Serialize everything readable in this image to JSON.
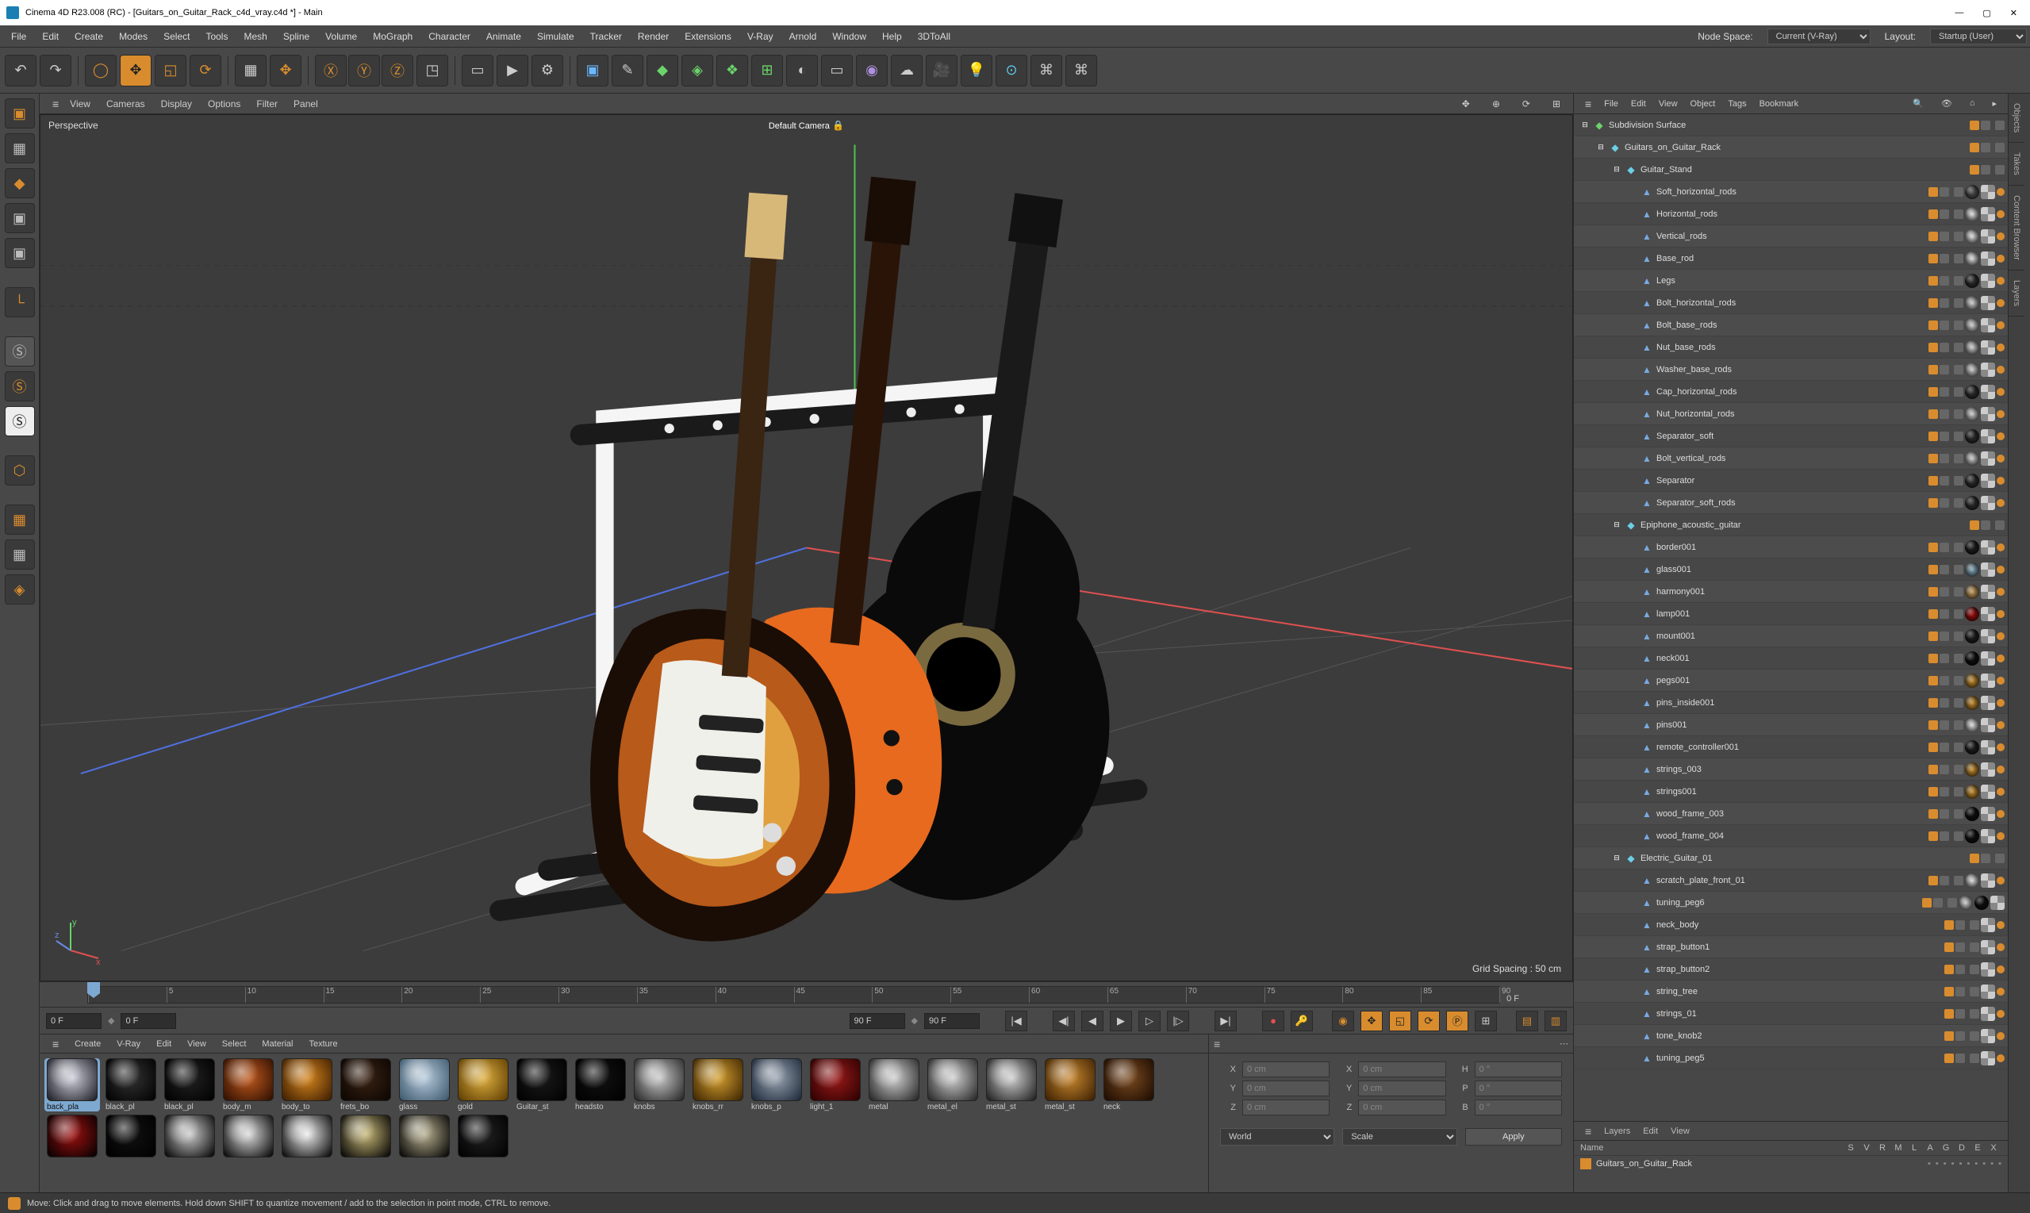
{
  "title": "Cinema 4D R23.008 (RC) - [Guitars_on_Guitar_Rack_c4d_vray.c4d *] - Main",
  "menubar": [
    "File",
    "Edit",
    "Create",
    "Modes",
    "Select",
    "Tools",
    "Mesh",
    "Spline",
    "Volume",
    "MoGraph",
    "Character",
    "Animate",
    "Simulate",
    "Tracker",
    "Render",
    "Extensions",
    "V-Ray",
    "Arnold",
    "Window",
    "Help",
    "3DToAll"
  ],
  "nodeSpaceLabel": "Node Space:",
  "nodeSpaceValue": "Current (V-Ray)",
  "layoutLabel": "Layout:",
  "layoutValue": "Startup (User)",
  "viewportMenus": [
    "View",
    "Cameras",
    "Display",
    "Options",
    "Filter",
    "Panel"
  ],
  "perspectiveLabel": "Perspective",
  "defaultCamera": "Default Camera",
  "gridSpacing": "Grid Spacing : 50 cm",
  "timelineStart": "0 F",
  "timelineStart2": "0 F",
  "timelineEnd": "90 F",
  "timelineEnd2": "90 F",
  "timelineRulerEnd": "0 F",
  "timelineTicks": [
    "0",
    "5",
    "10",
    "15",
    "20",
    "25",
    "30",
    "35",
    "40",
    "45",
    "50",
    "55",
    "60",
    "65",
    "70",
    "75",
    "80",
    "85",
    "90"
  ],
  "materialMenus": [
    "Create",
    "V-Ray",
    "Edit",
    "View",
    "Select",
    "Material",
    "Texture"
  ],
  "materials": [
    {
      "label": "back_pla",
      "c1": "#cfcfdc",
      "c2": "#1a1a22",
      "sel": true
    },
    {
      "label": "black_pl",
      "c1": "#333",
      "c2": "#000"
    },
    {
      "label": "black_pl",
      "c1": "#222",
      "c2": "#000"
    },
    {
      "label": "body_m",
      "c1": "#c15a1e",
      "c2": "#2a0d00"
    },
    {
      "label": "body_to",
      "c1": "#d6861e",
      "c2": "#3a1b00"
    },
    {
      "label": "frets_bo",
      "c1": "#3a2212",
      "c2": "#0a0502"
    },
    {
      "label": "glass",
      "c1": "#b8ccdd",
      "c2": "#3a556a"
    },
    {
      "label": "gold",
      "c1": "#e0b040",
      "c2": "#5a3a00"
    },
    {
      "label": "Guitar_st",
      "c1": "#1a1a1a",
      "c2": "#000"
    },
    {
      "label": "headsto",
      "c1": "#111",
      "c2": "#000"
    },
    {
      "label": "knobs",
      "c1": "#c9c9c9",
      "c2": "#222"
    },
    {
      "label": "knobs_rr",
      "c1": "#d5a030",
      "c2": "#3a2200"
    },
    {
      "label": "knobs_p",
      "c1": "#9aa4b2",
      "c2": "#1a2636"
    },
    {
      "label": "light_1",
      "c1": "#9c1a1a",
      "c2": "#2a0000"
    },
    {
      "label": "metal",
      "c1": "#d0d0d0",
      "c2": "#222"
    },
    {
      "label": "metal_el",
      "c1": "#d0d0d0",
      "c2": "#222"
    },
    {
      "label": "metal_st",
      "c1": "#d0d0d0",
      "c2": "#1a1a1a"
    },
    {
      "label": "metal_st",
      "c1": "#c88830",
      "c2": "#3a1e00"
    },
    {
      "label": "neck",
      "c1": "#7a4a20",
      "c2": "#1a0a00"
    }
  ],
  "materialsRow2Count": 8,
  "coord": {
    "x": "0 cm",
    "y": "0 cm",
    "z": "0 cm",
    "sx": "0 cm",
    "sy": "0 cm",
    "sz": "0 cm",
    "h": "0 °",
    "p": "0 °",
    "b": "0 °",
    "mode1": "World",
    "mode2": "Scale",
    "apply": "Apply"
  },
  "objMenus": [
    "File",
    "Edit",
    "View",
    "Object",
    "Tags",
    "Bookmark"
  ],
  "treeRoot": {
    "name": "Subdivision Surface",
    "icon": "◆",
    "iconColor": "#6bd36b",
    "depth": 0,
    "exp": "⊟",
    "tags": []
  },
  "tree": [
    {
      "name": "Guitars_on_Guitar_Rack",
      "icon": "◆",
      "iconColor": "#6bcfe6",
      "depth": 1,
      "exp": "⊟"
    },
    {
      "name": "Guitar_Stand",
      "icon": "◆",
      "iconColor": "#6bcfe6",
      "depth": 2,
      "exp": "⊟"
    },
    {
      "name": "Soft_horizontal_rods",
      "icon": "▲",
      "iconColor": "#7aa9e0",
      "depth": 3,
      "tags": [
        "sphere:#555",
        "check",
        "dot"
      ]
    },
    {
      "name": "Horizontal_rods",
      "icon": "▲",
      "iconColor": "#7aa9e0",
      "depth": 3,
      "tags": [
        "sphere:#ddd",
        "check",
        "dot"
      ]
    },
    {
      "name": "Vertical_rods",
      "icon": "▲",
      "iconColor": "#7aa9e0",
      "depth": 3,
      "tags": [
        "sphere:#ddd",
        "check",
        "dot"
      ]
    },
    {
      "name": "Base_rod",
      "icon": "▲",
      "iconColor": "#7aa9e0",
      "depth": 3,
      "tags": [
        "sphere:#ddd",
        "check",
        "dot"
      ]
    },
    {
      "name": "Legs",
      "icon": "▲",
      "iconColor": "#7aa9e0",
      "depth": 3,
      "tags": [
        "sphere:#333",
        "check",
        "dot"
      ]
    },
    {
      "name": "Bolt_horizontal_rods",
      "icon": "▲",
      "iconColor": "#7aa9e0",
      "depth": 3,
      "tags": [
        "sphere:#ccc",
        "check",
        "dot"
      ]
    },
    {
      "name": "Bolt_base_rods",
      "icon": "▲",
      "iconColor": "#7aa9e0",
      "depth": 3,
      "tags": [
        "sphere:#ccc",
        "check",
        "dot"
      ]
    },
    {
      "name": "Nut_base_rods",
      "icon": "▲",
      "iconColor": "#7aa9e0",
      "depth": 3,
      "tags": [
        "sphere:#ccc",
        "check",
        "dot"
      ]
    },
    {
      "name": "Washer_base_rods",
      "icon": "▲",
      "iconColor": "#7aa9e0",
      "depth": 3,
      "tags": [
        "sphere:#ccc",
        "check",
        "dot"
      ]
    },
    {
      "name": "Cap_horizontal_rods",
      "icon": "▲",
      "iconColor": "#7aa9e0",
      "depth": 3,
      "tags": [
        "sphere:#333",
        "check",
        "dot"
      ]
    },
    {
      "name": "Nut_horizontal_rods",
      "icon": "▲",
      "iconColor": "#7aa9e0",
      "depth": 3,
      "tags": [
        "sphere:#ccc",
        "check",
        "dot"
      ]
    },
    {
      "name": "Separator_soft",
      "icon": "▲",
      "iconColor": "#7aa9e0",
      "depth": 3,
      "tags": [
        "sphere:#333",
        "check",
        "dot"
      ]
    },
    {
      "name": "Bolt_vertical_rods",
      "icon": "▲",
      "iconColor": "#7aa9e0",
      "depth": 3,
      "tags": [
        "sphere:#ccc",
        "check",
        "dot"
      ]
    },
    {
      "name": "Separator",
      "icon": "▲",
      "iconColor": "#7aa9e0",
      "depth": 3,
      "tags": [
        "sphere:#333",
        "check",
        "dot"
      ]
    },
    {
      "name": "Separator_soft_rods",
      "icon": "▲",
      "iconColor": "#7aa9e0",
      "depth": 3,
      "tags": [
        "sphere:#333",
        "check",
        "dot"
      ]
    },
    {
      "name": "Epiphone_acoustic_guitar",
      "icon": "◆",
      "iconColor": "#6bcfe6",
      "depth": 2,
      "exp": "⊟"
    },
    {
      "name": "border001",
      "icon": "▲",
      "iconColor": "#7aa9e0",
      "depth": 3,
      "tags": [
        "sphere:#222",
        "check",
        "dot"
      ]
    },
    {
      "name": "glass001",
      "icon": "▲",
      "iconColor": "#7aa9e0",
      "depth": 3,
      "tags": [
        "sphere:#8ab",
        "check",
        "dot"
      ]
    },
    {
      "name": "harmony001",
      "icon": "▲",
      "iconColor": "#7aa9e0",
      "depth": 3,
      "tags": [
        "sphere:#c8a060",
        "check",
        "dot"
      ]
    },
    {
      "name": "lamp001",
      "icon": "▲",
      "iconColor": "#7aa9e0",
      "depth": 3,
      "tags": [
        "sphere:#a01010",
        "check",
        "dot"
      ]
    },
    {
      "name": "mount001",
      "icon": "▲",
      "iconColor": "#7aa9e0",
      "depth": 3,
      "tags": [
        "sphere:#222",
        "check",
        "dot"
      ]
    },
    {
      "name": "neck001",
      "icon": "▲",
      "iconColor": "#7aa9e0",
      "depth": 3,
      "tags": [
        "sphere:#111",
        "check",
        "dot"
      ]
    },
    {
      "name": "pegs001",
      "icon": "▲",
      "iconColor": "#7aa9e0",
      "depth": 3,
      "tags": [
        "sphere:#c89030",
        "check",
        "dot"
      ]
    },
    {
      "name": "pins_inside001",
      "icon": "▲",
      "iconColor": "#7aa9e0",
      "depth": 3,
      "tags": [
        "sphere:#c89030",
        "check",
        "dot"
      ]
    },
    {
      "name": "pins001",
      "icon": "▲",
      "iconColor": "#7aa9e0",
      "depth": 3,
      "tags": [
        "sphere:#ddd",
        "check",
        "dot"
      ]
    },
    {
      "name": "remote_controller001",
      "icon": "▲",
      "iconColor": "#7aa9e0",
      "depth": 3,
      "tags": [
        "sphere:#222",
        "check",
        "dot"
      ]
    },
    {
      "name": "strings_003",
      "icon": "▲",
      "iconColor": "#7aa9e0",
      "depth": 3,
      "tags": [
        "sphere:#c89030",
        "check",
        "dot"
      ]
    },
    {
      "name": "strings001",
      "icon": "▲",
      "iconColor": "#7aa9e0",
      "depth": 3,
      "tags": [
        "sphere:#c89030",
        "check",
        "dot"
      ]
    },
    {
      "name": "wood_frame_003",
      "icon": "▲",
      "iconColor": "#7aa9e0",
      "depth": 3,
      "tags": [
        "sphere:#111",
        "check",
        "dot"
      ]
    },
    {
      "name": "wood_frame_004",
      "icon": "▲",
      "iconColor": "#7aa9e0",
      "depth": 3,
      "tags": [
        "sphere:#111",
        "check",
        "dot"
      ]
    },
    {
      "name": "Electric_Guitar_01",
      "icon": "◆",
      "iconColor": "#6bcfe6",
      "depth": 2,
      "exp": "⊟"
    },
    {
      "name": "scratch_plate_front_01",
      "icon": "▲",
      "iconColor": "#7aa9e0",
      "depth": 3,
      "tags": [
        "sphere:#ddd",
        "check",
        "dot"
      ]
    },
    {
      "name": "tuning_peg6",
      "icon": "▲",
      "iconColor": "#7aa9e0",
      "depth": 3,
      "tags": [
        "sphere:#ccc",
        "sphere:#111",
        "check"
      ]
    },
    {
      "name": "neck_body",
      "icon": "▲",
      "iconColor": "#7aa9e0",
      "depth": 3,
      "tags": [
        "check",
        "dot"
      ]
    },
    {
      "name": "strap_button1",
      "icon": "▲",
      "iconColor": "#7aa9e0",
      "depth": 3,
      "tags": [
        "check",
        "dot"
      ]
    },
    {
      "name": "strap_button2",
      "icon": "▲",
      "iconColor": "#7aa9e0",
      "depth": 3,
      "tags": [
        "check",
        "dot"
      ]
    },
    {
      "name": "string_tree",
      "icon": "▲",
      "iconColor": "#7aa9e0",
      "depth": 3,
      "tags": [
        "check",
        "dot"
      ]
    },
    {
      "name": "strings_01",
      "icon": "▲",
      "iconColor": "#7aa9e0",
      "depth": 3,
      "tags": [
        "check",
        "dot"
      ]
    },
    {
      "name": "tone_knob2",
      "icon": "▲",
      "iconColor": "#7aa9e0",
      "depth": 3,
      "tags": [
        "check",
        "dot"
      ]
    },
    {
      "name": "tuning_peg5",
      "icon": "▲",
      "iconColor": "#7aa9e0",
      "depth": 3,
      "tags": [
        "check",
        "dot"
      ]
    }
  ],
  "layersMenus": [
    "Layers",
    "Edit",
    "View"
  ],
  "layersHeadName": "Name",
  "layersHeadCols": [
    "S",
    "V",
    "R",
    "M",
    "L",
    "A",
    "G",
    "D",
    "E",
    "X"
  ],
  "layerName": "Guitars_on_Guitar_Rack",
  "statusText": "Move: Click and drag to move elements. Hold down SHIFT to quantize movement / add to the selection in point mode, CTRL to remove.",
  "rightTabs": [
    "Objects",
    "Takes",
    "Content Browser",
    "Layers"
  ]
}
